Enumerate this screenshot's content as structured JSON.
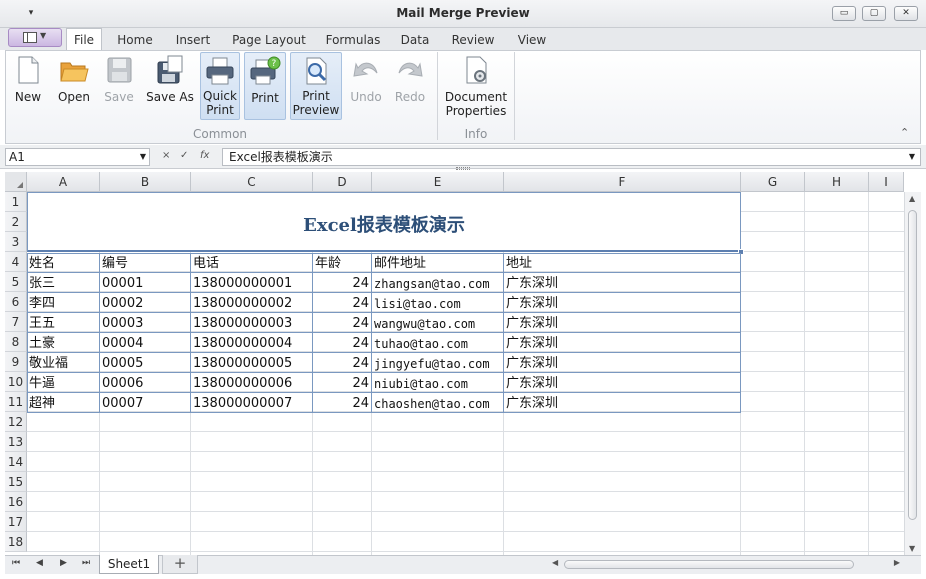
{
  "window": {
    "title": "Mail Merge Preview",
    "quick_access": "▾",
    "btn_minimize": "▭",
    "btn_restore": "▢",
    "btn_close": "✕"
  },
  "tabs": [
    "File",
    "Home",
    "Insert",
    "Page Layout",
    "Formulas",
    "Data",
    "Review",
    "View"
  ],
  "active_tab": "File",
  "ribbon": {
    "buttons": {
      "new": "New",
      "open": "Open",
      "save": "Save",
      "save_as": "Save As",
      "quick_print_1": "Quick",
      "quick_print_2": "Print",
      "print": "Print",
      "print_preview_1": "Print",
      "print_preview_2": "Preview",
      "undo": "Undo",
      "redo": "Redo",
      "doc_props_1": "Document",
      "doc_props_2": "Properties"
    },
    "groups": {
      "common": "Common",
      "info": "Info"
    }
  },
  "formula_bar": {
    "name_box": "A1",
    "cancel": "×",
    "enter": "✓",
    "fx": "fx",
    "content": "Excel报表模板演示"
  },
  "columns": [
    "A",
    "B",
    "C",
    "D",
    "E",
    "F",
    "G",
    "H",
    "I"
  ],
  "rows": [
    "1",
    "2",
    "3",
    "4",
    "5",
    "6",
    "7",
    "8",
    "9",
    "10",
    "11",
    "12",
    "13",
    "14",
    "15",
    "16",
    "17",
    "18"
  ],
  "sheet": {
    "title": "Excel报表模板演示",
    "headers": [
      "姓名",
      "编号",
      "电话",
      "年龄",
      "邮件地址",
      "地址"
    ],
    "records": [
      [
        "张三",
        "00001",
        "138000000001",
        "24",
        "zhangsan@tao.com",
        "广东深圳"
      ],
      [
        "李四",
        "00002",
        "138000000002",
        "24",
        "lisi@tao.com",
        "广东深圳"
      ],
      [
        "王五",
        "00003",
        "138000000003",
        "24",
        "wangwu@tao.com",
        "广东深圳"
      ],
      [
        "土豪",
        "00004",
        "138000000004",
        "24",
        "tuhao@tao.com",
        "广东深圳"
      ],
      [
        "敬业福",
        "00005",
        "138000000005",
        "24",
        "jingyefu@tao.com",
        "广东深圳"
      ],
      [
        "牛逼",
        "00006",
        "138000000006",
        "24",
        "niubi@tao.com",
        "广东深圳"
      ],
      [
        "超神",
        "00007",
        "138000000007",
        "24",
        "chaoshen@tao.com",
        "广东深圳"
      ]
    ]
  },
  "sheet_tabs": {
    "active": "Sheet1",
    "add": "+"
  },
  "nav": {
    "first": "⏮",
    "prev": "◀",
    "next": "▶",
    "last": "⏭"
  }
}
